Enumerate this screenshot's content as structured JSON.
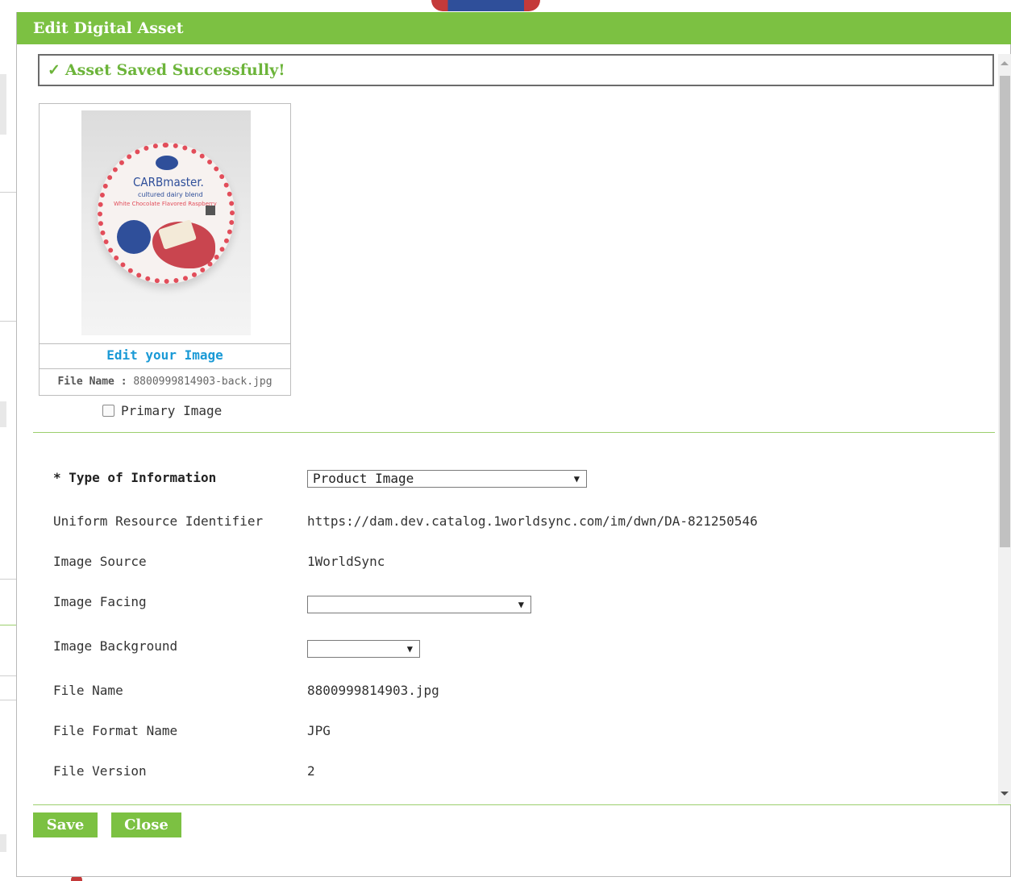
{
  "dialog": {
    "title": "Edit Digital Asset",
    "success_message": "Asset Saved Successfully!"
  },
  "image_card": {
    "edit_link": "Edit your Image",
    "file_name_label": "File Name :",
    "file_name_value": "8800999814903-back.jpg",
    "product_brand_prefix": "CARB",
    "product_brand_suffix": "master.",
    "product_subtitle": "cultured dairy blend",
    "product_flavor": "White Chocolate Flavored Raspberry"
  },
  "primary_image": {
    "label": "Primary Image",
    "checked": false
  },
  "form": {
    "type_of_information": {
      "label": "* Type of Information",
      "value": "Product Image"
    },
    "uri": {
      "label": "Uniform Resource Identifier",
      "value": "https://dam.dev.catalog.1worldsync.com/im/dwn/DA-821250546"
    },
    "image_source": {
      "label": "Image Source",
      "value": "1WorldSync"
    },
    "image_facing": {
      "label": "Image Facing",
      "value": ""
    },
    "image_background": {
      "label": "Image Background",
      "value": ""
    },
    "file_name": {
      "label": "File Name",
      "value": "8800999814903.jpg"
    },
    "file_format_name": {
      "label": "File Format Name",
      "value": "JPG"
    },
    "file_version": {
      "label": "File Version",
      "value": "2"
    }
  },
  "buttons": {
    "save": "Save",
    "close": "Close"
  },
  "icons": {
    "success": "checkmark-icon",
    "dropdown": "caret-down-icon"
  },
  "colors": {
    "brand_green": "#7cc142",
    "success_text": "#6cb43a",
    "link_blue": "#1a9ad6"
  }
}
